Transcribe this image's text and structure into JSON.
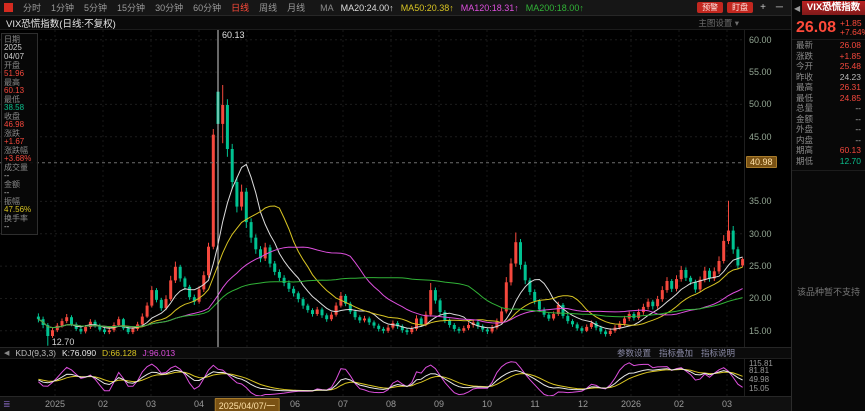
{
  "colors": {
    "up": "#f5483d",
    "down": "#00c291"
  },
  "toolbar": {
    "tabs": [
      "分时",
      "1分钟",
      "5分钟",
      "15分钟",
      "30分钟",
      "60分钟",
      "日线",
      "周线",
      "月线"
    ],
    "active_tab": "日线",
    "ma_prefix": "MA",
    "ma_items": [
      {
        "label": "MA20:24.00↑",
        "color": "#dcdcdc"
      },
      {
        "label": "MA50:20.38↑",
        "color": "#d8c422"
      },
      {
        "label": "MA120:18.31↑",
        "color": "#dd4fdd"
      },
      {
        "label": "MA200:18.00↑",
        "color": "#31b337"
      }
    ],
    "buttons": [
      "预警",
      "盯盘"
    ],
    "window_controls": [
      "+",
      "─"
    ]
  },
  "symbol_bar": {
    "title": "VIX恐慌指数(日线:不复权)",
    "right_hint": "主图设置 ▾"
  },
  "info_panel": {
    "rows": [
      {
        "label": "日期",
        "value": "2025",
        "value2": "04/07",
        "cls": "white"
      },
      {
        "label": "开盘",
        "value": "51.96",
        "cls": "up"
      },
      {
        "label": "最高",
        "value": "60.13",
        "cls": "up"
      },
      {
        "label": "最低",
        "value": "38.58",
        "cls": "down"
      },
      {
        "label": "收盘",
        "value": "46.98",
        "cls": "up"
      },
      {
        "label": "涨跌",
        "value": "+1.67",
        "cls": "up"
      },
      {
        "label": "涨跌幅",
        "value": "+3.68%",
        "cls": "up"
      },
      {
        "label": "成交量",
        "value": "--",
        "cls": "white"
      },
      {
        "label": "金额",
        "value": "--",
        "cls": "white"
      },
      {
        "label": "振幅",
        "value": "47.56%",
        "cls": "yellow"
      },
      {
        "label": "换手率",
        "value": "--",
        "cls": "white"
      }
    ]
  },
  "chart": {
    "type": "candlestick",
    "ylim": [
      12.5,
      61.5
    ],
    "price_ticks": [
      "60.00",
      "55.00",
      "50.00",
      "45.00",
      "35.00",
      "30.00",
      "25.00",
      "20.00",
      "15.00"
    ],
    "crosshair": {
      "index": 38,
      "price_label": "40.98",
      "date_label": "2025/04/07/一"
    },
    "annotations": {
      "high": "60.13",
      "low": "12.70"
    },
    "ma_windows": [
      8,
      15,
      30,
      55
    ],
    "candles": [
      [
        17.2,
        17.7,
        16.3,
        16.8
      ],
      [
        16.8,
        17.2,
        15.4,
        15.9
      ],
      [
        15.9,
        16.2,
        12.7,
        14.2
      ],
      [
        14.2,
        15.5,
        13.9,
        15.1
      ],
      [
        15.1,
        16.2,
        14.8,
        15.8
      ],
      [
        15.8,
        16.9,
        15.5,
        16.5
      ],
      [
        16.5,
        17.6,
        16.2,
        17.1
      ],
      [
        17.1,
        17.4,
        15.7,
        16.0
      ],
      [
        16.0,
        16.3,
        15.0,
        15.3
      ],
      [
        15.3,
        15.6,
        14.5,
        14.9
      ],
      [
        14.9,
        15.9,
        14.6,
        15.6
      ],
      [
        15.6,
        16.8,
        15.3,
        16.4
      ],
      [
        16.4,
        16.7,
        15.5,
        15.8
      ],
      [
        15.8,
        16.1,
        14.9,
        15.2
      ],
      [
        15.2,
        15.5,
        14.5,
        14.8
      ],
      [
        14.8,
        15.5,
        14.5,
        15.1
      ],
      [
        15.1,
        16.3,
        14.8,
        15.9
      ],
      [
        15.9,
        17.2,
        15.6,
        16.8
      ],
      [
        16.8,
        17.0,
        15.1,
        15.4
      ],
      [
        15.4,
        15.7,
        14.5,
        14.8
      ],
      [
        14.8,
        15.7,
        14.5,
        15.3
      ],
      [
        15.3,
        16.4,
        15.0,
        16.0
      ],
      [
        16.0,
        17.7,
        15.8,
        17.2
      ],
      [
        17.2,
        19.4,
        17.0,
        18.9
      ],
      [
        18.9,
        21.9,
        18.6,
        21.3
      ],
      [
        21.3,
        21.6,
        19.4,
        19.8
      ],
      [
        19.8,
        20.1,
        18.1,
        18.5
      ],
      [
        18.5,
        20.5,
        18.2,
        19.9
      ],
      [
        19.9,
        23.5,
        19.6,
        22.8
      ],
      [
        22.8,
        25.7,
        22.4,
        24.9
      ],
      [
        24.9,
        25.2,
        22.6,
        23.1
      ],
      [
        23.1,
        23.4,
        21.3,
        21.8
      ],
      [
        21.8,
        22.1,
        19.8,
        20.2
      ],
      [
        20.2,
        20.6,
        19.0,
        19.5
      ],
      [
        19.5,
        21.9,
        19.2,
        21.4
      ],
      [
        21.4,
        24.2,
        21.0,
        23.6
      ],
      [
        23.6,
        28.6,
        23.2,
        28.0
      ],
      [
        28.0,
        46.2,
        27.6,
        45.31
      ],
      [
        51.96,
        60.13,
        38.58,
        46.98
      ],
      [
        46.98,
        53.0,
        44.0,
        49.9
      ],
      [
        49.9,
        50.8,
        41.9,
        43.1
      ],
      [
        43.1,
        43.9,
        36.9,
        38.0
      ],
      [
        38.0,
        38.8,
        33.3,
        34.2
      ],
      [
        34.2,
        37.6,
        33.6,
        36.5
      ],
      [
        36.5,
        37.1,
        30.9,
        31.8
      ],
      [
        31.8,
        32.4,
        28.6,
        29.4
      ],
      [
        29.4,
        29.9,
        26.9,
        27.6
      ],
      [
        27.6,
        28.1,
        25.6,
        26.2
      ],
      [
        26.2,
        28.6,
        25.8,
        27.9
      ],
      [
        27.9,
        28.3,
        24.8,
        25.4
      ],
      [
        25.4,
        25.8,
        23.6,
        24.1
      ],
      [
        24.1,
        24.5,
        22.7,
        23.2
      ],
      [
        23.2,
        23.6,
        21.9,
        22.4
      ],
      [
        22.4,
        22.8,
        21.0,
        21.5
      ],
      [
        21.5,
        21.9,
        20.3,
        20.8
      ],
      [
        20.8,
        21.1,
        19.4,
        19.9
      ],
      [
        19.9,
        20.2,
        18.4,
        18.9
      ],
      [
        18.9,
        19.2,
        17.8,
        18.2
      ],
      [
        18.2,
        18.5,
        17.2,
        17.6
      ],
      [
        17.6,
        18.7,
        17.3,
        18.3
      ],
      [
        18.3,
        18.6,
        17.0,
        17.4
      ],
      [
        17.4,
        17.7,
        16.4,
        16.8
      ],
      [
        16.8,
        17.9,
        16.5,
        17.5
      ],
      [
        17.5,
        19.4,
        17.2,
        18.9
      ],
      [
        18.9,
        21.0,
        18.6,
        20.4
      ],
      [
        20.4,
        20.7,
        18.8,
        19.2
      ],
      [
        19.2,
        19.5,
        17.6,
        18.0
      ],
      [
        18.0,
        18.3,
        16.7,
        17.1
      ],
      [
        17.1,
        17.4,
        16.2,
        16.6
      ],
      [
        16.6,
        17.3,
        16.3,
        16.9
      ],
      [
        16.9,
        17.2,
        15.9,
        16.3
      ],
      [
        16.3,
        16.6,
        15.4,
        15.8
      ],
      [
        15.8,
        16.1,
        14.9,
        15.3
      ],
      [
        15.3,
        15.6,
        14.6,
        15.0
      ],
      [
        15.0,
        15.9,
        14.7,
        15.5
      ],
      [
        15.5,
        16.6,
        15.2,
        16.2
      ],
      [
        16.2,
        16.5,
        15.3,
        15.7
      ],
      [
        15.7,
        16.0,
        14.7,
        15.1
      ],
      [
        15.1,
        15.4,
        14.4,
        14.8
      ],
      [
        14.8,
        15.7,
        14.5,
        15.3
      ],
      [
        15.3,
        17.4,
        15.0,
        16.9
      ],
      [
        16.9,
        17.2,
        15.6,
        16.0
      ],
      [
        16.0,
        18.0,
        15.7,
        17.5
      ],
      [
        17.5,
        22.4,
        17.2,
        21.3
      ],
      [
        21.3,
        21.7,
        19.2,
        19.7
      ],
      [
        19.7,
        20.0,
        17.5,
        17.9
      ],
      [
        17.9,
        18.2,
        16.2,
        16.6
      ],
      [
        16.6,
        16.9,
        15.5,
        15.9
      ],
      [
        15.9,
        16.2,
        14.9,
        15.3
      ],
      [
        15.3,
        15.6,
        14.6,
        15.0
      ],
      [
        15.0,
        15.8,
        14.7,
        15.4
      ],
      [
        15.4,
        16.3,
        15.1,
        15.9
      ],
      [
        15.9,
        16.7,
        15.5,
        16.3
      ],
      [
        16.3,
        16.6,
        15.3,
        15.7
      ],
      [
        15.7,
        16.0,
        14.8,
        15.2
      ],
      [
        15.2,
        15.5,
        14.5,
        14.9
      ],
      [
        14.9,
        15.9,
        14.6,
        15.5
      ],
      [
        15.5,
        16.9,
        15.2,
        16.4
      ],
      [
        16.4,
        18.6,
        16.1,
        18.0
      ],
      [
        18.0,
        23.3,
        17.7,
        22.5
      ],
      [
        22.5,
        26.2,
        22.0,
        25.4
      ],
      [
        25.4,
        30.2,
        24.9,
        28.7
      ],
      [
        28.7,
        29.2,
        24.5,
        25.2
      ],
      [
        25.2,
        25.7,
        22.2,
        22.8
      ],
      [
        22.8,
        23.2,
        20.5,
        21.0
      ],
      [
        21.0,
        21.4,
        19.1,
        19.6
      ],
      [
        19.6,
        19.9,
        17.9,
        18.3
      ],
      [
        18.3,
        18.6,
        17.1,
        17.5
      ],
      [
        17.5,
        17.8,
        16.5,
        16.9
      ],
      [
        16.9,
        18.0,
        16.6,
        17.6
      ],
      [
        17.6,
        19.5,
        17.3,
        19.0
      ],
      [
        19.0,
        19.3,
        16.9,
        17.3
      ],
      [
        17.3,
        17.6,
        16.1,
        16.5
      ],
      [
        16.5,
        16.8,
        15.6,
        16.0
      ],
      [
        16.0,
        16.3,
        15.0,
        15.4
      ],
      [
        15.4,
        15.7,
        14.6,
        15.0
      ],
      [
        15.0,
        16.0,
        14.8,
        15.6
      ],
      [
        15.6,
        16.6,
        15.3,
        16.2
      ],
      [
        16.2,
        16.5,
        15.1,
        15.5
      ],
      [
        15.5,
        15.8,
        14.5,
        14.9
      ],
      [
        14.9,
        15.2,
        14.1,
        14.5
      ],
      [
        14.5,
        15.4,
        14.2,
        15.0
      ],
      [
        15.0,
        15.9,
        14.7,
        15.5
      ],
      [
        15.5,
        16.5,
        15.2,
        16.1
      ],
      [
        16.1,
        17.3,
        15.8,
        16.9
      ],
      [
        16.9,
        18.0,
        16.5,
        17.6
      ],
      [
        17.6,
        17.9,
        16.6,
        17.0
      ],
      [
        17.0,
        18.4,
        16.7,
        17.9
      ],
      [
        17.9,
        19.2,
        17.5,
        18.7
      ],
      [
        18.7,
        20.0,
        18.3,
        19.5
      ],
      [
        19.5,
        19.8,
        18.3,
        18.8
      ],
      [
        18.8,
        20.4,
        18.4,
        19.9
      ],
      [
        19.9,
        21.9,
        19.5,
        21.3
      ],
      [
        21.3,
        23.3,
        20.9,
        22.7
      ],
      [
        22.7,
        23.0,
        21.0,
        21.5
      ],
      [
        21.5,
        23.6,
        21.1,
        23.0
      ],
      [
        23.0,
        25.0,
        22.6,
        24.4
      ],
      [
        24.4,
        24.8,
        22.7,
        23.2
      ],
      [
        23.2,
        23.5,
        22.1,
        22.6
      ],
      [
        22.6,
        22.9,
        20.9,
        21.4
      ],
      [
        21.4,
        23.4,
        21.0,
        22.9
      ],
      [
        22.9,
        24.9,
        22.5,
        24.3
      ],
      [
        24.3,
        24.7,
        22.6,
        23.1
      ],
      [
        23.1,
        24.8,
        22.7,
        24.2
      ],
      [
        24.2,
        26.5,
        23.8,
        25.8
      ],
      [
        25.8,
        29.8,
        25.4,
        28.9
      ],
      [
        28.9,
        35.1,
        28.4,
        30.5
      ],
      [
        30.5,
        31.2,
        26.9,
        27.6
      ],
      [
        27.6,
        28.0,
        24.5,
        25.1
      ],
      [
        25.1,
        26.31,
        24.85,
        26.08
      ]
    ]
  },
  "kdj": {
    "label": "KDJ(9,3,3)",
    "k_label": "K:76.090",
    "d_label": "D:66.128",
    "j_label": "J:96.013",
    "colors": {
      "k": "#e8e8e8",
      "d": "#d8c422",
      "j": "#dd4fdd"
    },
    "ylim": [
      -15,
      125
    ],
    "axis": [
      "115.81",
      "81.81",
      "49.98",
      "15.05"
    ],
    "links": [
      "参数设置",
      "指标叠加",
      "指标说明"
    ]
  },
  "date_axis": {
    "labels": [
      "2025",
      "02",
      "03",
      "04",
      "2025/04/07/一",
      "06",
      "07",
      "08",
      "09",
      "10",
      "11",
      "12",
      "2026",
      "02",
      "03"
    ],
    "highlight_index": 4
  },
  "right_panel": {
    "title": "VIX恐慌指数",
    "price": "26.08",
    "change": "+1.85",
    "pct": "+7.64%",
    "rows": [
      {
        "label": "最新",
        "value": "26.08",
        "cls": "up"
      },
      {
        "label": "涨跌",
        "value": "+1.85",
        "cls": "up"
      },
      {
        "label": "今开",
        "value": "25.48",
        "cls": "up"
      },
      {
        "label": "昨收",
        "value": "24.23",
        "cls": "flat"
      },
      {
        "label": "最高",
        "value": "26.31",
        "cls": "up"
      },
      {
        "label": "最低",
        "value": "24.85",
        "cls": "up"
      },
      {
        "label": "总量",
        "value": "--",
        "cls": "flat"
      },
      {
        "label": "金额",
        "value": "--",
        "cls": "flat"
      },
      {
        "label": "外盘",
        "value": "--",
        "cls": "flat"
      },
      {
        "label": "内盘",
        "value": "--",
        "cls": "flat"
      },
      {
        "label": "期高",
        "value": "60.13",
        "cls": "up"
      },
      {
        "label": "期低",
        "value": "12.70",
        "cls": "down"
      }
    ],
    "message": "该品种暂不支持"
  }
}
